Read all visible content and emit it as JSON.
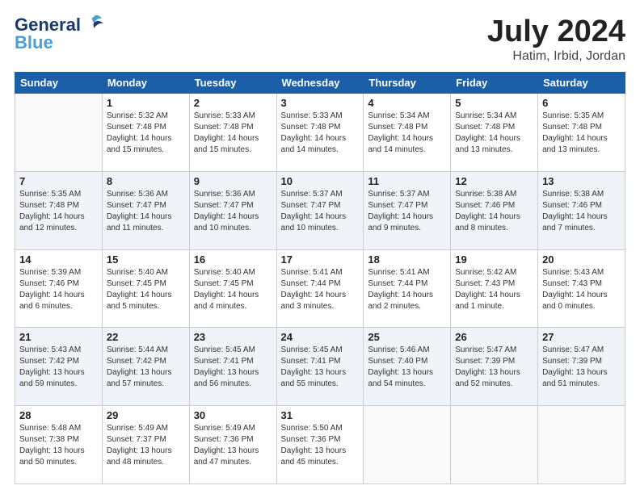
{
  "logo": {
    "line1": "General",
    "line2": "Blue"
  },
  "header": {
    "month": "July 2024",
    "location": "Hatim, Irbid, Jordan"
  },
  "weekdays": [
    "Sunday",
    "Monday",
    "Tuesday",
    "Wednesday",
    "Thursday",
    "Friday",
    "Saturday"
  ],
  "weeks": [
    [
      {
        "day": "",
        "info": ""
      },
      {
        "day": "1",
        "info": "Sunrise: 5:32 AM\nSunset: 7:48 PM\nDaylight: 14 hours\nand 15 minutes."
      },
      {
        "day": "2",
        "info": "Sunrise: 5:33 AM\nSunset: 7:48 PM\nDaylight: 14 hours\nand 15 minutes."
      },
      {
        "day": "3",
        "info": "Sunrise: 5:33 AM\nSunset: 7:48 PM\nDaylight: 14 hours\nand 14 minutes."
      },
      {
        "day": "4",
        "info": "Sunrise: 5:34 AM\nSunset: 7:48 PM\nDaylight: 14 hours\nand 14 minutes."
      },
      {
        "day": "5",
        "info": "Sunrise: 5:34 AM\nSunset: 7:48 PM\nDaylight: 14 hours\nand 13 minutes."
      },
      {
        "day": "6",
        "info": "Sunrise: 5:35 AM\nSunset: 7:48 PM\nDaylight: 14 hours\nand 13 minutes."
      }
    ],
    [
      {
        "day": "7",
        "info": "Sunrise: 5:35 AM\nSunset: 7:48 PM\nDaylight: 14 hours\nand 12 minutes."
      },
      {
        "day": "8",
        "info": "Sunrise: 5:36 AM\nSunset: 7:47 PM\nDaylight: 14 hours\nand 11 minutes."
      },
      {
        "day": "9",
        "info": "Sunrise: 5:36 AM\nSunset: 7:47 PM\nDaylight: 14 hours\nand 10 minutes."
      },
      {
        "day": "10",
        "info": "Sunrise: 5:37 AM\nSunset: 7:47 PM\nDaylight: 14 hours\nand 10 minutes."
      },
      {
        "day": "11",
        "info": "Sunrise: 5:37 AM\nSunset: 7:47 PM\nDaylight: 14 hours\nand 9 minutes."
      },
      {
        "day": "12",
        "info": "Sunrise: 5:38 AM\nSunset: 7:46 PM\nDaylight: 14 hours\nand 8 minutes."
      },
      {
        "day": "13",
        "info": "Sunrise: 5:38 AM\nSunset: 7:46 PM\nDaylight: 14 hours\nand 7 minutes."
      }
    ],
    [
      {
        "day": "14",
        "info": "Sunrise: 5:39 AM\nSunset: 7:46 PM\nDaylight: 14 hours\nand 6 minutes."
      },
      {
        "day": "15",
        "info": "Sunrise: 5:40 AM\nSunset: 7:45 PM\nDaylight: 14 hours\nand 5 minutes."
      },
      {
        "day": "16",
        "info": "Sunrise: 5:40 AM\nSunset: 7:45 PM\nDaylight: 14 hours\nand 4 minutes."
      },
      {
        "day": "17",
        "info": "Sunrise: 5:41 AM\nSunset: 7:44 PM\nDaylight: 14 hours\nand 3 minutes."
      },
      {
        "day": "18",
        "info": "Sunrise: 5:41 AM\nSunset: 7:44 PM\nDaylight: 14 hours\nand 2 minutes."
      },
      {
        "day": "19",
        "info": "Sunrise: 5:42 AM\nSunset: 7:43 PM\nDaylight: 14 hours\nand 1 minute."
      },
      {
        "day": "20",
        "info": "Sunrise: 5:43 AM\nSunset: 7:43 PM\nDaylight: 14 hours\nand 0 minutes."
      }
    ],
    [
      {
        "day": "21",
        "info": "Sunrise: 5:43 AM\nSunset: 7:42 PM\nDaylight: 13 hours\nand 59 minutes."
      },
      {
        "day": "22",
        "info": "Sunrise: 5:44 AM\nSunset: 7:42 PM\nDaylight: 13 hours\nand 57 minutes."
      },
      {
        "day": "23",
        "info": "Sunrise: 5:45 AM\nSunset: 7:41 PM\nDaylight: 13 hours\nand 56 minutes."
      },
      {
        "day": "24",
        "info": "Sunrise: 5:45 AM\nSunset: 7:41 PM\nDaylight: 13 hours\nand 55 minutes."
      },
      {
        "day": "25",
        "info": "Sunrise: 5:46 AM\nSunset: 7:40 PM\nDaylight: 13 hours\nand 54 minutes."
      },
      {
        "day": "26",
        "info": "Sunrise: 5:47 AM\nSunset: 7:39 PM\nDaylight: 13 hours\nand 52 minutes."
      },
      {
        "day": "27",
        "info": "Sunrise: 5:47 AM\nSunset: 7:39 PM\nDaylight: 13 hours\nand 51 minutes."
      }
    ],
    [
      {
        "day": "28",
        "info": "Sunrise: 5:48 AM\nSunset: 7:38 PM\nDaylight: 13 hours\nand 50 minutes."
      },
      {
        "day": "29",
        "info": "Sunrise: 5:49 AM\nSunset: 7:37 PM\nDaylight: 13 hours\nand 48 minutes."
      },
      {
        "day": "30",
        "info": "Sunrise: 5:49 AM\nSunset: 7:36 PM\nDaylight: 13 hours\nand 47 minutes."
      },
      {
        "day": "31",
        "info": "Sunrise: 5:50 AM\nSunset: 7:36 PM\nDaylight: 13 hours\nand 45 minutes."
      },
      {
        "day": "",
        "info": ""
      },
      {
        "day": "",
        "info": ""
      },
      {
        "day": "",
        "info": ""
      }
    ]
  ]
}
